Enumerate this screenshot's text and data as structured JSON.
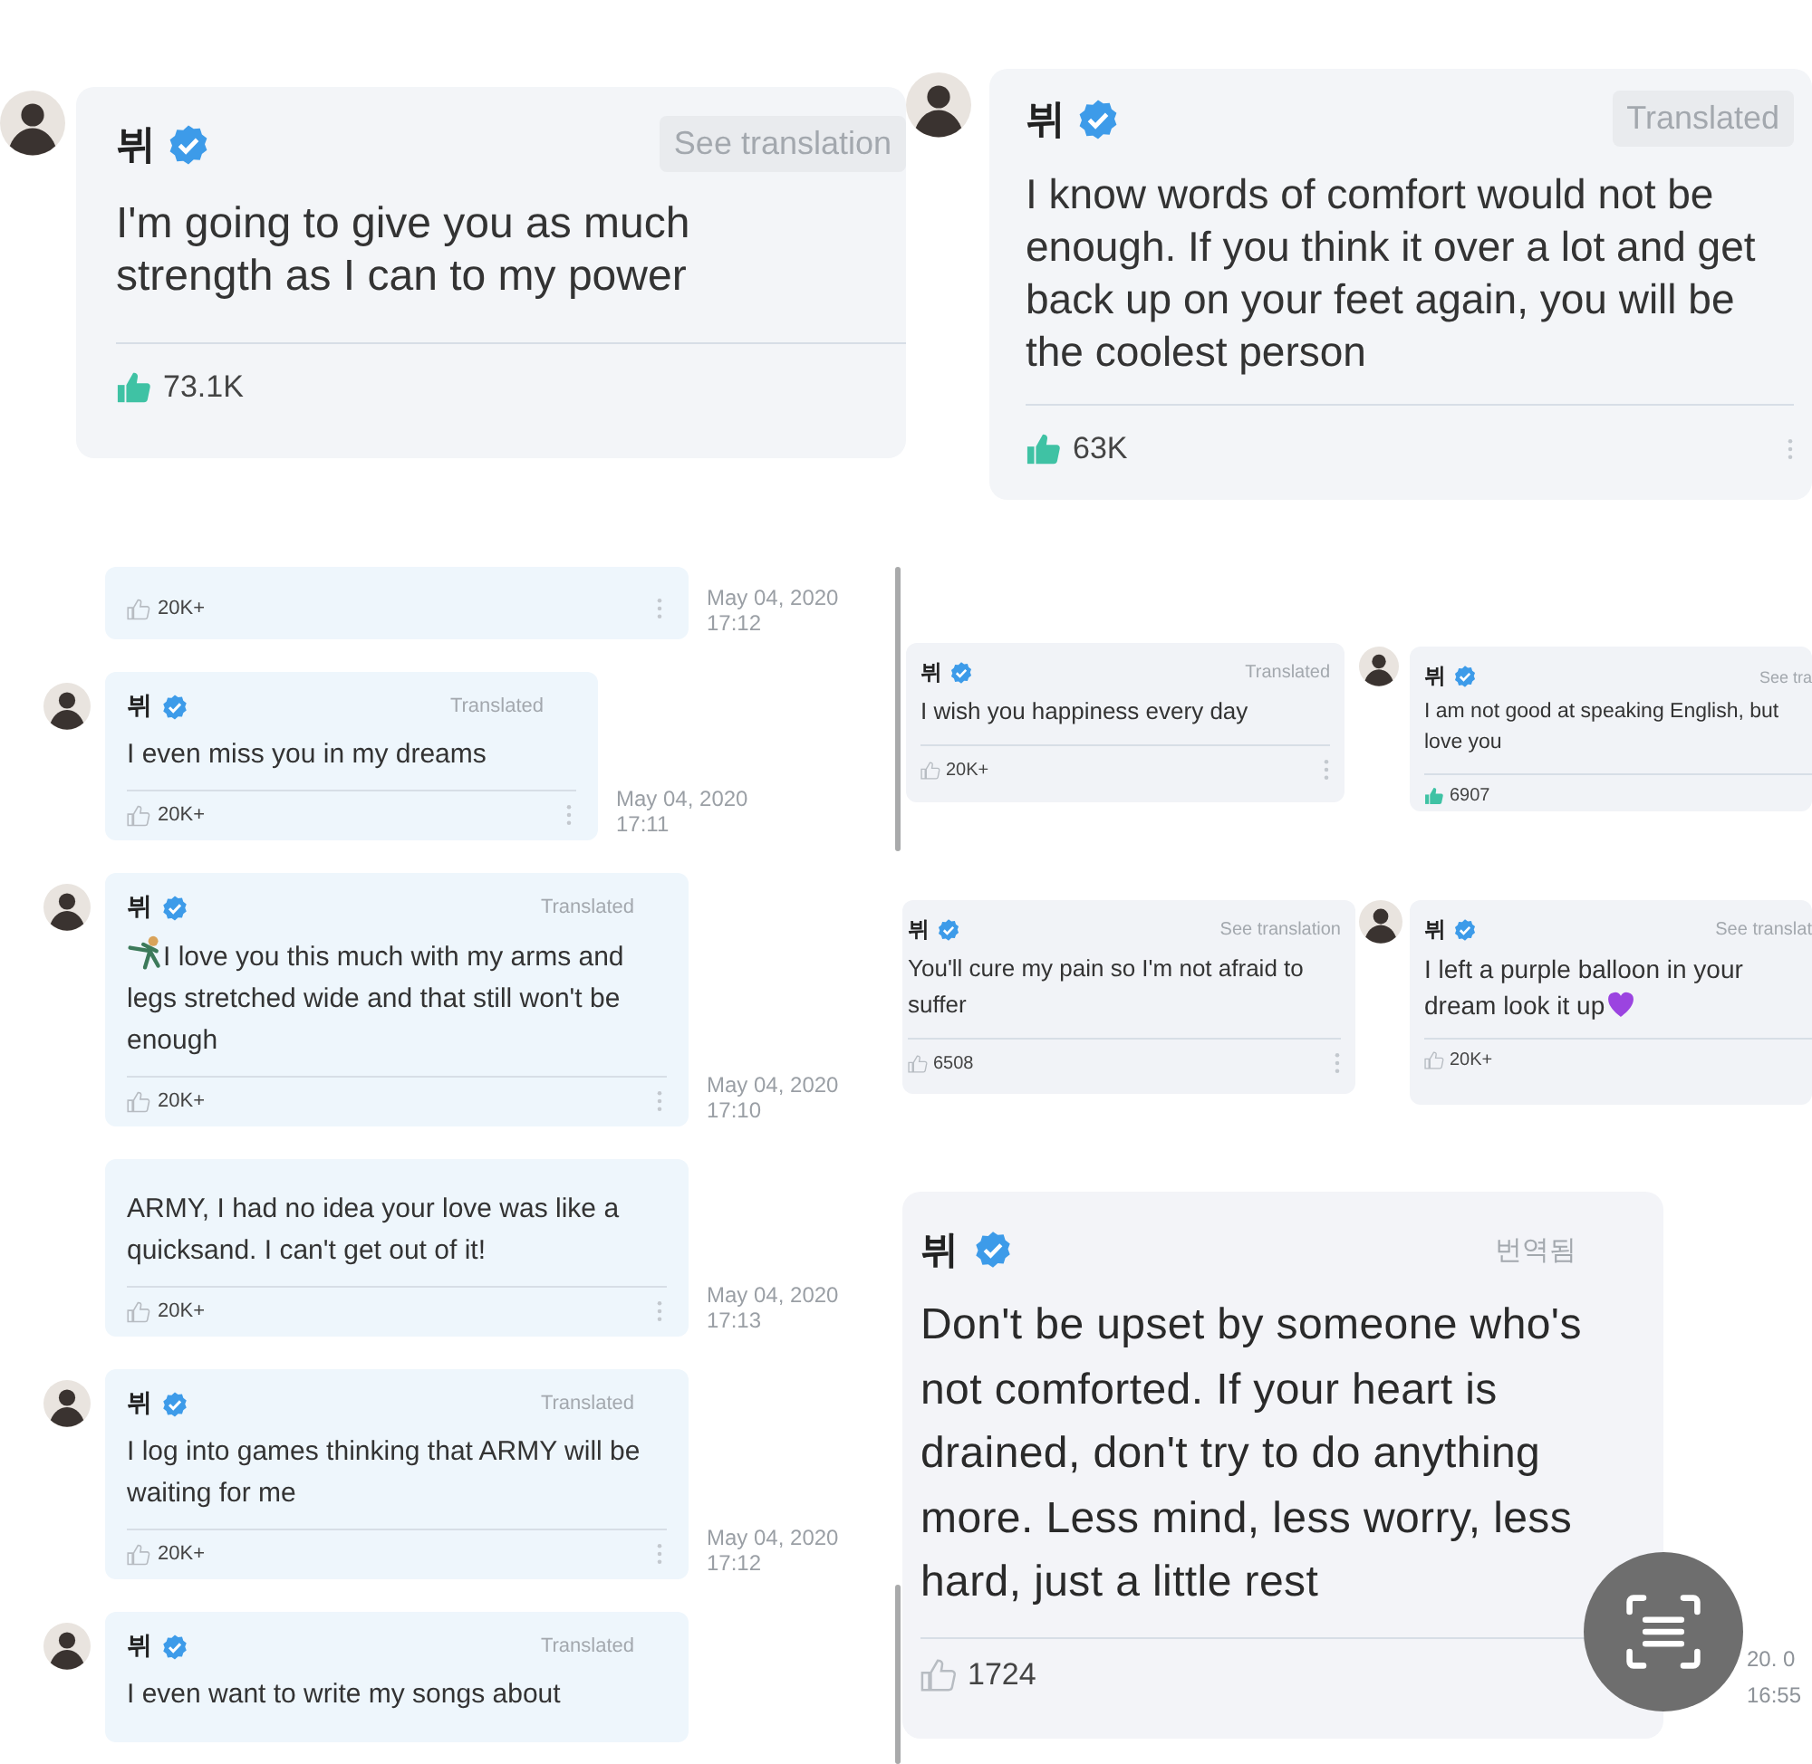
{
  "panels": [
    {
      "kind": "feature",
      "comments": [
        {
          "avatar": true,
          "name": "뷔",
          "verified": true,
          "tag": "See translation",
          "text": "I'm going to give you as much strength as I can to my power",
          "likes": "73.1K",
          "liked": true,
          "menu": false
        }
      ]
    },
    {
      "kind": "feature",
      "comments": [
        {
          "avatar": true,
          "name": "뷔",
          "verified": true,
          "tag": "Translated",
          "text": "I know words of comfort would not be enough. If you think it over a lot and get back up on your feet again, you will be the coolest person",
          "likes": "63K",
          "liked": true,
          "menu": true
        }
      ]
    },
    {
      "kind": "thread",
      "comments": [
        {
          "avatar": false,
          "likes": "20K+",
          "liked": false,
          "menu": true,
          "date": "May 04, 2020",
          "time": "17:12"
        },
        {
          "avatar": true,
          "name": "뷔",
          "verified": true,
          "tag": "Translated",
          "text": "I even miss you in my dreams",
          "likes": "20K+",
          "liked": false,
          "menu": true,
          "date": "May 04, 2020",
          "time": "17:11"
        },
        {
          "avatar": true,
          "name": "뷔",
          "verified": true,
          "tag": "Translated",
          "leading_emoji": {
            "kind": "figure"
          },
          "text": "I love you this much with my arms and legs stretched wide and that still won't be enough",
          "likes": "20K+",
          "liked": false,
          "menu": true,
          "date": "May 04, 2020",
          "time": "17:10"
        },
        {
          "avatar": false,
          "text": "ARMY, I had no idea your love was like a quicksand. I can't get out of it!",
          "likes": "20K+",
          "liked": false,
          "menu": true,
          "date": "May 04, 2020",
          "time": "17:13"
        },
        {
          "avatar": true,
          "name": "뷔",
          "verified": true,
          "tag": "Translated",
          "text": "I log into games thinking that ARMY will be waiting for me",
          "likes": "20K+",
          "liked": false,
          "menu": true,
          "date": "May 04, 2020",
          "time": "17:12"
        },
        {
          "avatar": true,
          "name": "뷔",
          "verified": true,
          "tag": "Translated",
          "text": "I even want to write my songs about"
        }
      ]
    },
    {
      "kind": "card",
      "comments": [
        {
          "avatar": false,
          "name": "뷔",
          "verified": true,
          "tag": "Translated",
          "text": "I wish you happiness every day",
          "likes": "20K+",
          "liked": false,
          "menu": true
        }
      ]
    },
    {
      "kind": "card",
      "comments": [
        {
          "avatar": true,
          "name": "뷔",
          "verified": true,
          "tag": "See tra",
          "text": "I am not good at speaking English, but love you",
          "likes": "6907",
          "liked": true,
          "menu": false
        }
      ]
    },
    {
      "kind": "card",
      "comments": [
        {
          "avatar": false,
          "name": "뷔",
          "verified": true,
          "tag": "See translation",
          "text": "You'll cure my pain so I'm not afraid to suffer",
          "likes": "6508",
          "liked": false,
          "menu": true
        }
      ]
    },
    {
      "kind": "card",
      "comments": [
        {
          "avatar": true,
          "name": "뷔",
          "verified": true,
          "tag": "See translat",
          "text": "I left a purple balloon in your dream look it up",
          "trailing_emoji": {
            "kind": "heart"
          },
          "likes": "20K+",
          "liked": false,
          "menu": false
        }
      ]
    },
    {
      "kind": "large",
      "comments": [
        {
          "avatar": false,
          "name": "뷔",
          "verified": true,
          "tag": "번역됨",
          "text": "Don't be upset by someone who's not comforted. If your heart is drained, don't try to do anything more. Less mind, less worry, less hard, just a little rest",
          "likes": "1724",
          "liked": false,
          "menu": false,
          "date": "20. 0",
          "time": "16:55"
        }
      ]
    }
  ]
}
